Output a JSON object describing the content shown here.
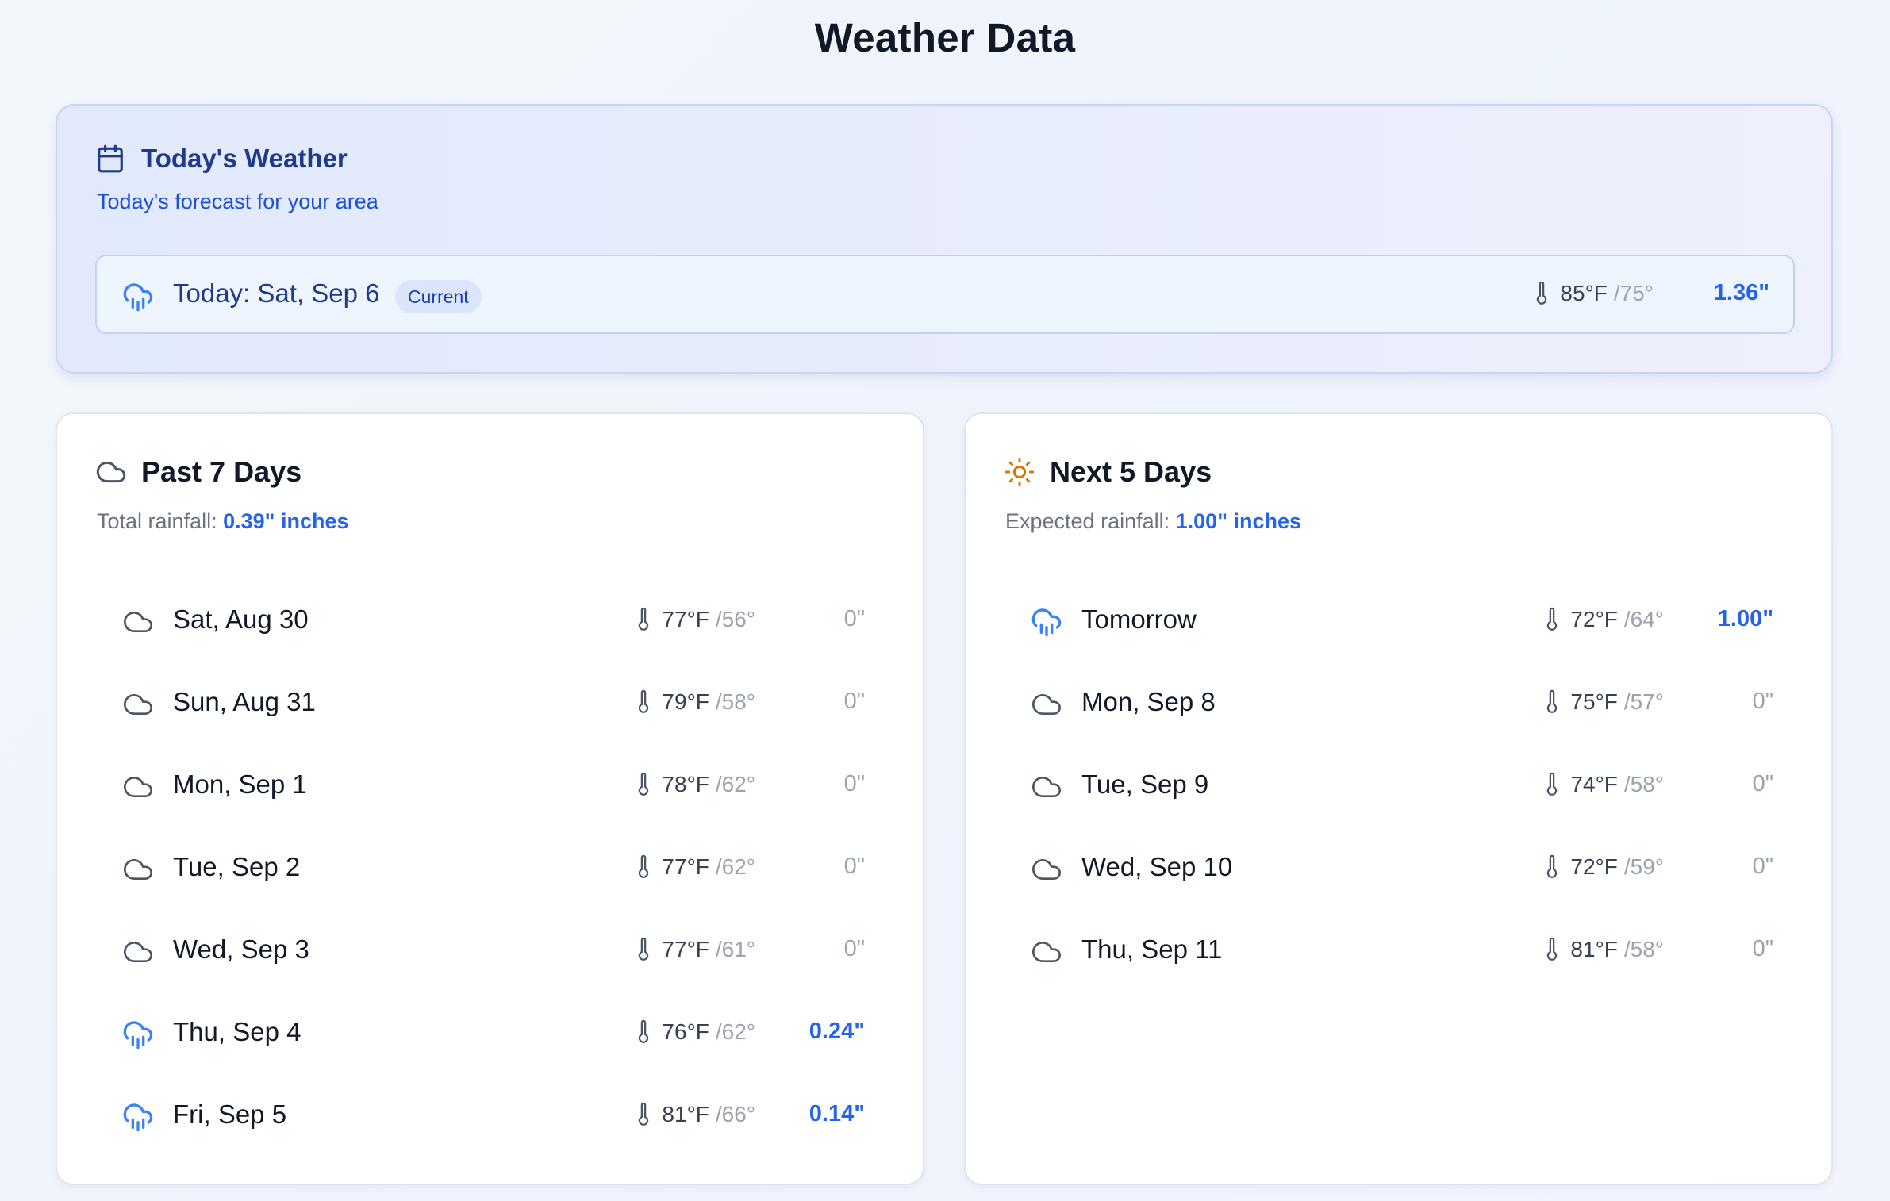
{
  "page": {
    "title": "Weather Data"
  },
  "today": {
    "title": "Today's Weather",
    "subtitle": "Today's forecast for your area",
    "icon": "calendar-icon",
    "row": {
      "label": "Today: Sat, Sep 6",
      "badge": "Current",
      "weather": "rain",
      "high": "85°F",
      "low": "/75°",
      "rain": "1.36\""
    }
  },
  "past": {
    "title": "Past 7 Days",
    "icon": "cloud-icon",
    "rain_label": "Total rainfall:",
    "rain_value": "0.39\" inches",
    "days": [
      {
        "day": "Sat, Aug 30",
        "weather": "cloud",
        "high": "77°F",
        "low": "/56°",
        "rain": "0\""
      },
      {
        "day": "Sun, Aug 31",
        "weather": "cloud",
        "high": "79°F",
        "low": "/58°",
        "rain": "0\""
      },
      {
        "day": "Mon, Sep 1",
        "weather": "cloud",
        "high": "78°F",
        "low": "/62°",
        "rain": "0\""
      },
      {
        "day": "Tue, Sep 2",
        "weather": "cloud",
        "high": "77°F",
        "low": "/62°",
        "rain": "0\""
      },
      {
        "day": "Wed, Sep 3",
        "weather": "cloud",
        "high": "77°F",
        "low": "/61°",
        "rain": "0\""
      },
      {
        "day": "Thu, Sep 4",
        "weather": "rain",
        "high": "76°F",
        "low": "/62°",
        "rain": "0.24\""
      },
      {
        "day": "Fri, Sep 5",
        "weather": "rain",
        "high": "81°F",
        "low": "/66°",
        "rain": "0.14\""
      }
    ]
  },
  "next": {
    "title": "Next 5 Days",
    "icon": "sun-icon",
    "rain_label": "Expected rainfall:",
    "rain_value": "1.00\" inches",
    "days": [
      {
        "day": "Tomorrow",
        "weather": "rain",
        "high": "72°F",
        "low": "/64°",
        "rain": "1.00\""
      },
      {
        "day": "Mon, Sep 8",
        "weather": "cloud",
        "high": "75°F",
        "low": "/57°",
        "rain": "0\""
      },
      {
        "day": "Tue, Sep 9",
        "weather": "cloud",
        "high": "74°F",
        "low": "/58°",
        "rain": "0\""
      },
      {
        "day": "Wed, Sep 10",
        "weather": "cloud",
        "high": "72°F",
        "low": "/59°",
        "rain": "0\""
      },
      {
        "day": "Thu, Sep 11",
        "weather": "cloud",
        "high": "81°F",
        "low": "/58°",
        "rain": "0\""
      }
    ]
  },
  "colors": {
    "accent": "#2563eb",
    "today_bg": "#e4eafd",
    "title_dark": "#1e3a8a",
    "muted": "#9ca3af",
    "sun": "#d97706"
  }
}
